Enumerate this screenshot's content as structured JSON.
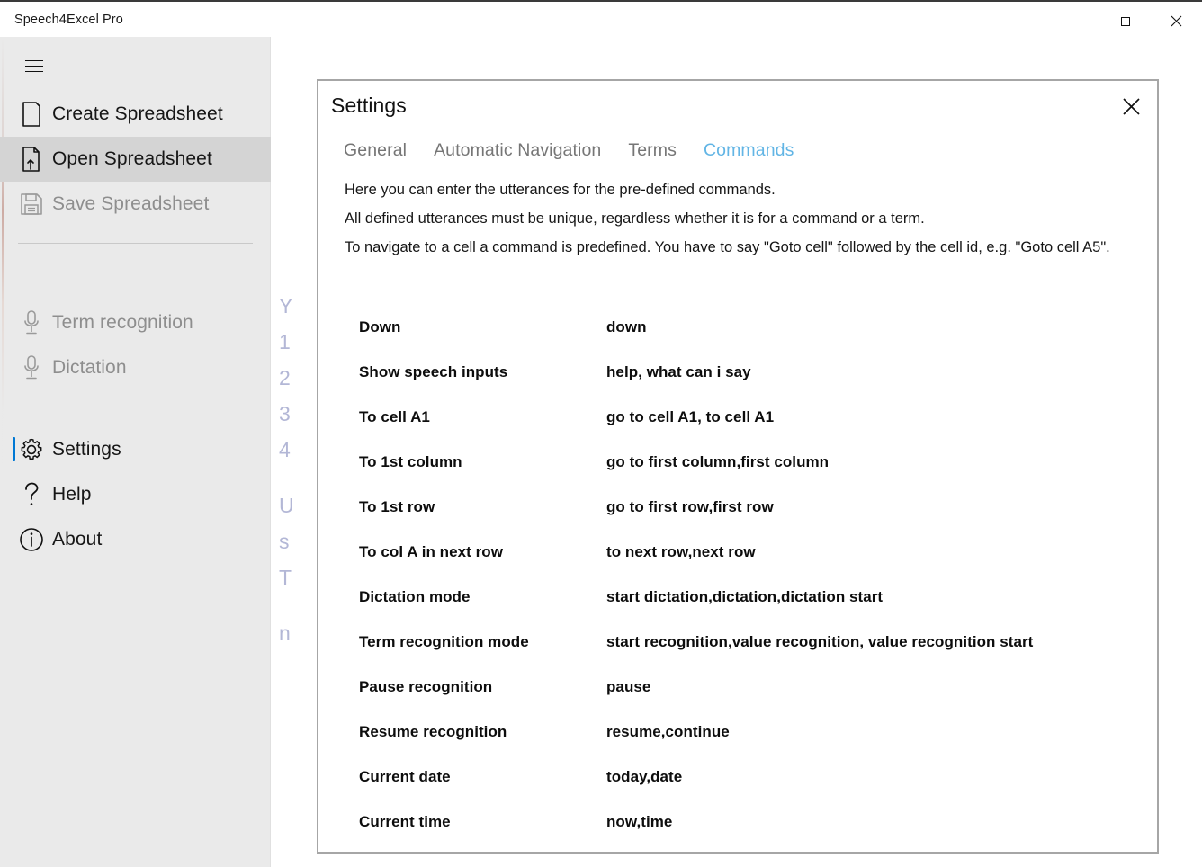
{
  "window": {
    "title": "Speech4Excel Pro",
    "controls": [
      {
        "name": "minimize",
        "label": "—"
      },
      {
        "name": "maximize",
        "label": "☐"
      },
      {
        "name": "close",
        "label": "✕"
      }
    ]
  },
  "sidebar": {
    "menu_button": "hamburger-menu",
    "items": [
      {
        "label": "Create Spreadsheet",
        "icon": "document-icon",
        "state": "enabled"
      },
      {
        "label": "Open Spreadsheet",
        "icon": "open-document-icon",
        "state": "selected"
      },
      {
        "label": "Save Spreadsheet",
        "icon": "save-disk-icon",
        "state": "disabled"
      },
      {
        "label": "Term recognition",
        "icon": "microphone-icon",
        "state": "disabled"
      },
      {
        "label": "Dictation",
        "icon": "microphone-icon",
        "state": "disabled"
      },
      {
        "label": "Settings",
        "icon": "gear-icon",
        "state": "active"
      },
      {
        "label": "Help",
        "icon": "question-mark-icon",
        "state": "enabled"
      },
      {
        "label": "About",
        "icon": "info-circle-icon",
        "state": "enabled"
      }
    ],
    "accent_color": "#0078d4",
    "background_color": "#eaeaea",
    "selected_color": "#d4d4d4"
  },
  "background_content": {
    "color": "#b3b7d6",
    "lines": [
      "Y",
      "1",
      "2",
      "3",
      "4",
      "U",
      "s",
      "T",
      "n"
    ]
  },
  "dialog": {
    "title": "Settings",
    "close_label": "✕",
    "tabs": [
      {
        "label": "General",
        "active": false
      },
      {
        "label": "Automatic Navigation",
        "active": false
      },
      {
        "label": "Terms",
        "active": false
      },
      {
        "label": "Commands",
        "active": true
      }
    ],
    "active_tab_color": "#62b5e5",
    "description": [
      "Here you can enter the utterances for the pre-defined commands.",
      "All defined utterances must be unique, regardless whether it is for a command or a term.",
      "To navigate to a cell a command is predefined. You have to say \"Goto cell\" followed by the cell id, e.g. \"Goto cell A5\"."
    ],
    "commands": [
      {
        "name": "Down",
        "utterances": "down"
      },
      {
        "name": "Show speech inputs",
        "utterances": "help, what can i say"
      },
      {
        "name": "To cell A1",
        "utterances": "go to cell A1, to cell A1"
      },
      {
        "name": "To 1st column",
        "utterances": "go to first column,first column"
      },
      {
        "name": "To 1st row",
        "utterances": "go to first row,first row"
      },
      {
        "name": "To col A in next row",
        "utterances": "to next row,next row"
      },
      {
        "name": "Dictation mode",
        "utterances": "start dictation,dictation,dictation start"
      },
      {
        "name": "Term recognition mode",
        "utterances": "start recognition,value recognition, value recognition start"
      },
      {
        "name": "Pause recognition",
        "utterances": "pause"
      },
      {
        "name": "Resume recognition",
        "utterances": "resume,continue"
      },
      {
        "name": "Current date",
        "utterances": "today,date"
      },
      {
        "name": "Current time",
        "utterances": "now,time"
      }
    ]
  }
}
